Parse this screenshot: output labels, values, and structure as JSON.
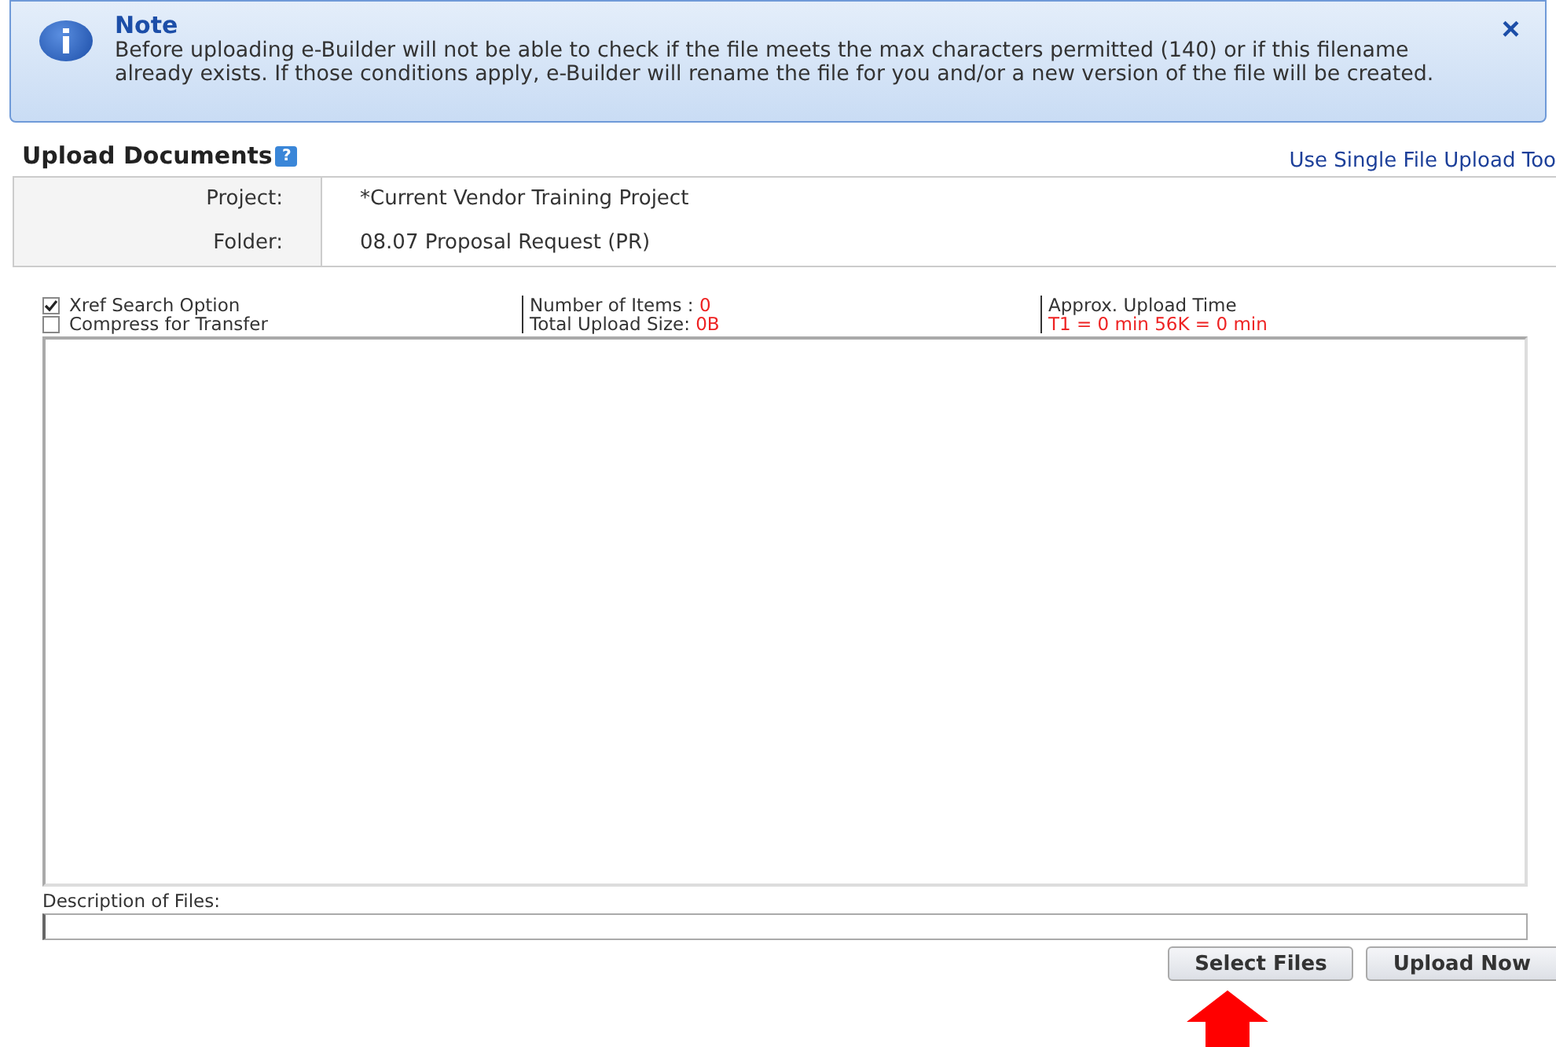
{
  "note": {
    "title": "Note",
    "text": "Before uploading e-Builder will not be able to check if the file meets the max characters permitted (140) or if this filename already exists. If those conditions apply, e-Builder will rename the file for you and/or a new version of the file will be created.",
    "close": "×"
  },
  "header": {
    "title": "Upload Documents",
    "help": "?",
    "link": "Use Single File Upload Too"
  },
  "info": [
    {
      "label": "Project:",
      "value": "*Current Vendor Training Project"
    },
    {
      "label": "Folder:",
      "value": "08.07 Proposal Request (PR)"
    }
  ],
  "options": [
    {
      "label": "Xref Search Option",
      "checked": true
    },
    {
      "label": "Compress for Transfer",
      "checked": false
    }
  ],
  "stats": {
    "items_label": "Number of Items  :",
    "items_value": "0",
    "size_label": "Total Upload Size:",
    "size_value": "0B",
    "time_label": "Approx. Upload Time",
    "time_value": "T1 = 0 min  56K = 0 min"
  },
  "description": {
    "label": "Description of Files:"
  },
  "buttons": [
    "Select Files",
    "Upload Now"
  ]
}
